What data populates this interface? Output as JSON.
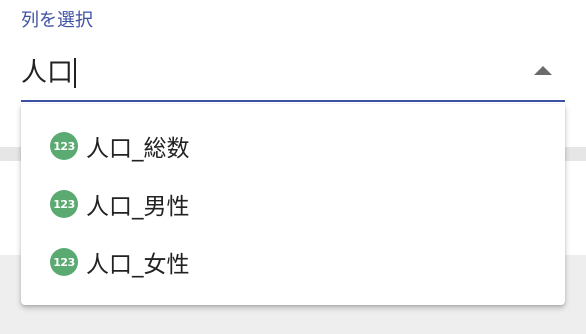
{
  "column_select": {
    "label": "列を選択",
    "input_value": "人口",
    "options": [
      {
        "icon": "123",
        "icon_name": "numeric-type-icon",
        "label": "人口_総数"
      },
      {
        "icon": "123",
        "icon_name": "numeric-type-icon",
        "label": "人口_男性"
      },
      {
        "icon": "123",
        "icon_name": "numeric-type-icon",
        "label": "人口_女性"
      }
    ]
  },
  "colors": {
    "accent": "#3f51a5",
    "numeric_badge": "#5aaa72"
  }
}
